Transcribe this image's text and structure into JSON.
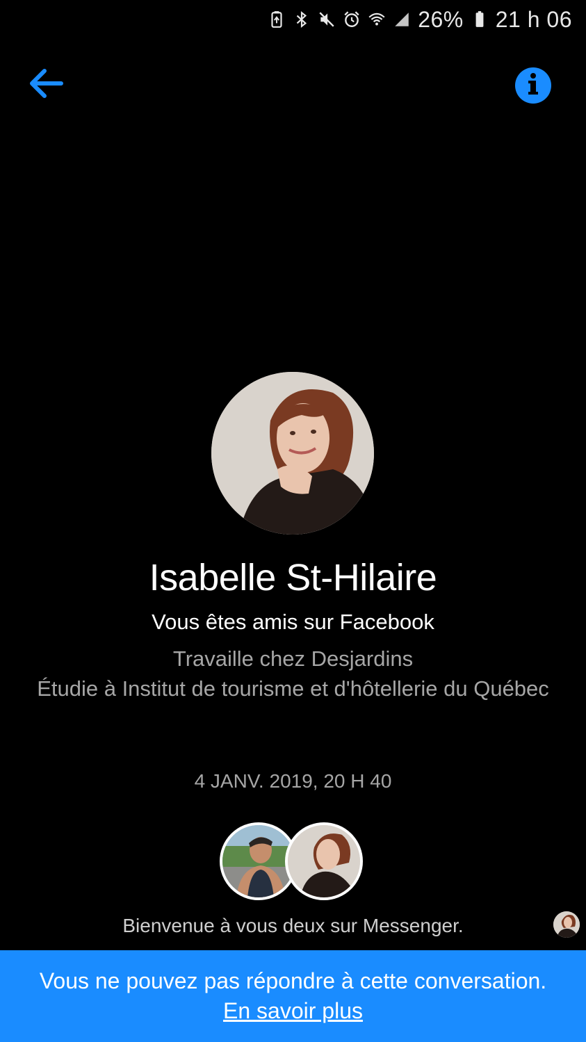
{
  "status_bar": {
    "battery_percent": "26%",
    "time": "21 h 06",
    "icons": [
      "battery-saver-icon",
      "bluetooth-icon",
      "mute-icon",
      "alarm-icon",
      "wifi-icon",
      "signal-icon",
      "battery-icon"
    ]
  },
  "nav": {
    "back_icon": "arrow-left-icon",
    "info_icon": "info-icon"
  },
  "profile": {
    "name": "Isabelle St-Hilaire",
    "friend_status": "Vous êtes amis sur Facebook",
    "work": "Travaille chez Desjardins",
    "education": "Étudie à Institut de tourisme et d'hôtellerie du Québec"
  },
  "conversation": {
    "timestamp": "4 JANV. 2019, 20 H 40",
    "welcome_message": "Bienvenue à vous deux sur Messenger."
  },
  "banner": {
    "message": "Vous ne pouvez pas répondre à cette conversation.",
    "link_label": "En savoir plus"
  },
  "colors": {
    "accent": "#1a8cff",
    "background": "#000000",
    "secondary_text": "#a6a6a6"
  }
}
